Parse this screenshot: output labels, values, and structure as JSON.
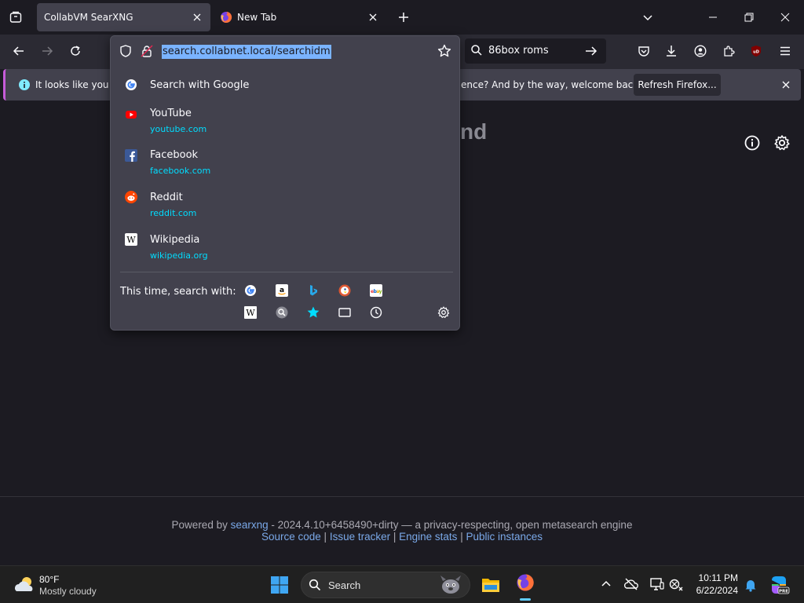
{
  "tabs": [
    {
      "title": "CollabVM SearXNG",
      "active": true
    },
    {
      "title": "New Tab",
      "active": false
    }
  ],
  "urlbar": {
    "url": "search.collabnet.local/searchidm"
  },
  "search_bar": {
    "value": "86box roms"
  },
  "suggestions": [
    {
      "title": "Search with Google",
      "url": "",
      "icon": "google-icon"
    },
    {
      "title": "YouTube",
      "url": "youtube.com",
      "icon": "youtube-icon"
    },
    {
      "title": "Facebook",
      "url": "facebook.com",
      "icon": "facebook-icon"
    },
    {
      "title": "Reddit",
      "url": "reddit.com",
      "icon": "reddit-icon"
    },
    {
      "title": "Wikipedia",
      "url": "wikipedia.org",
      "icon": "wikipedia-icon"
    }
  ],
  "oneoff": {
    "label": "This time, search with:",
    "engines": [
      "google-icon",
      "amazon-icon",
      "bing-icon",
      "duckduckgo-icon",
      "ebay-icon",
      "wikipedia-icon",
      "searxng-icon",
      "bookmarks-icon",
      "tabs-icon",
      "history-icon"
    ]
  },
  "notification": {
    "text_left": "It looks like you ha",
    "text_right": "ence? And by the way, welcome back!",
    "button": "Refresh Firefox..."
  },
  "page": {
    "heading_partial": "nd"
  },
  "footer": {
    "powered_by": "Powered by",
    "searxng_link": "searxng",
    "version_text": "- 2024.4.10+6458490+dirty — a privacy-respecting, open metasearch engine",
    "source_code": "Source code",
    "issue_tracker": "Issue tracker",
    "engine_stats": "Engine stats",
    "public_instances": "Public instances",
    "separator": "|"
  },
  "taskbar": {
    "weather_temp": "80°F",
    "weather_desc": "Mostly cloudy",
    "search_placeholder": "Search",
    "time": "10:11 PM",
    "date": "6/22/2024"
  },
  "colors": {
    "accent_blue": "#7ab3ff",
    "link_cyan": "#00ddff",
    "notification_accent": "#c65bd9",
    "ublock_red": "#800000"
  }
}
